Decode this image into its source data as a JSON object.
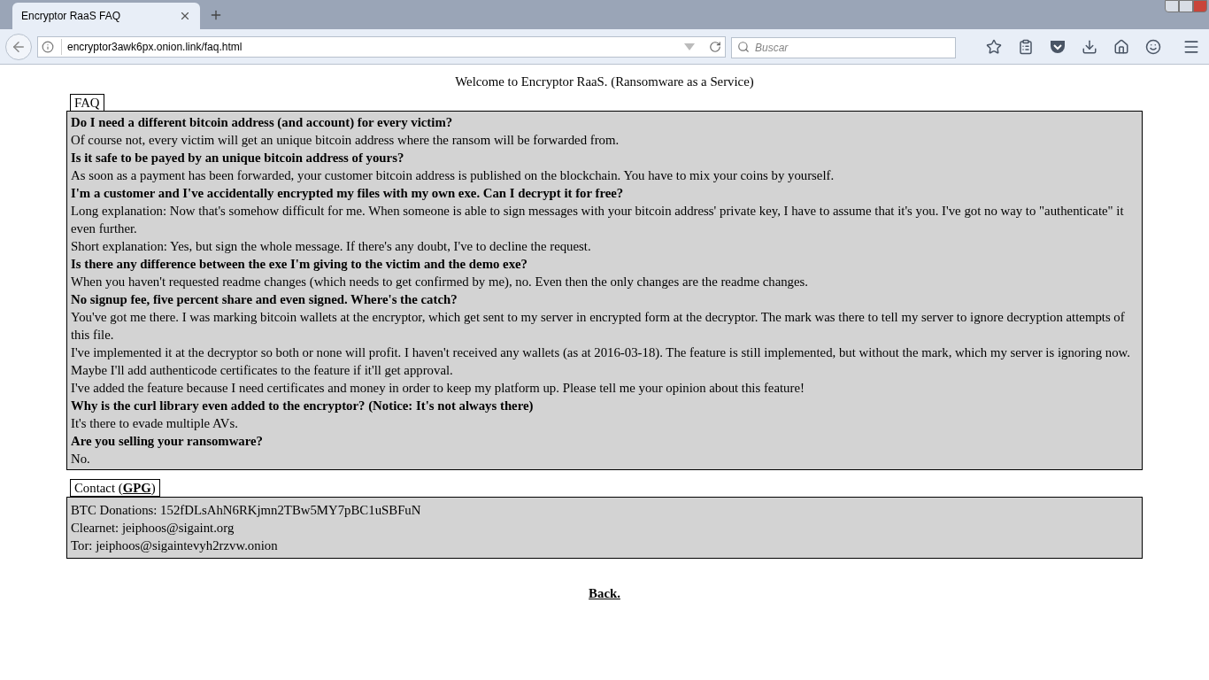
{
  "browser": {
    "tabs": [
      {
        "title": "Encryptor RaaS FAQ",
        "selected": true
      }
    ],
    "url": "encryptor3awk6px.onion.link/faq.html",
    "search": {
      "placeholder": "Buscar"
    }
  },
  "page": {
    "heading": "Welcome to Encryptor RaaS. (Ransomware as a Service)",
    "faq": {
      "legend": "FAQ",
      "items": [
        {
          "question": "Do I need a different bitcoin address (and account) for every victim?",
          "answers": [
            "Of course not, every victim will get an unique bitcoin address where the ransom will be forwarded from."
          ]
        },
        {
          "question": "Is it safe to be payed by an unique bitcoin address of yours?",
          "answers": [
            "As soon as a payment has been forwarded, your customer bitcoin address is published on the blockchain. You have to mix your coins by yourself."
          ]
        },
        {
          "question": "I'm a customer and I've accidentally encrypted my files with my own exe. Can I decrypt it for free?",
          "answers": [
            "Long explanation: Now that's somehow difficult for me. When someone is able to sign messages with your bitcoin address' private key, I have to assume that it's you. I've got no way to \"authenticate\" it even further.",
            "Short explanation: Yes, but sign the whole message. If there's any doubt, I've to decline the request."
          ]
        },
        {
          "question": "Is there any difference between the exe I'm giving to the victim and the demo exe?",
          "answers": [
            "When you haven't requested readme changes (which needs to get confirmed by me), no. Even then the only changes are the readme changes."
          ]
        },
        {
          "question": "No signup fee, five percent share and even signed. Where's the catch?",
          "answers": [
            "You've got me there. I was marking bitcoin wallets at the encryptor, which get sent to my server in encrypted form at the decryptor. The mark was there to tell my server to ignore decryption attempts of this file.",
            "I've implemented it at the decryptor so both or none will profit. I haven't received any wallets (as at 2016-03-18). The feature is still implemented, but without the mark, which my server is ignoring now.",
            "Maybe I'll add authenticode certificates to the feature if it'll get approval.",
            "I've added the feature because I need certificates and money in order to keep my platform up. Please tell me your opinion about this feature!"
          ]
        },
        {
          "question": "Why is the curl library even added to the encryptor? (Notice: It's not always there)",
          "answers": [
            "It's there to evade multiple AVs."
          ]
        },
        {
          "question": "Are you selling your ransomware?",
          "answers": [
            "No."
          ]
        }
      ]
    },
    "contact": {
      "legend_before": "Contact (",
      "legend_link": "GPG",
      "legend_after": ")",
      "lines": [
        "BTC Donations: 152fDLsAhN6RKjmn2TBw5MY7pBC1uSBFuN",
        "Clearnet: jeiphoos@sigaint.org",
        "Tor: jeiphoos@sigaintevyh2rzvw.onion"
      ]
    },
    "back": "Back."
  }
}
